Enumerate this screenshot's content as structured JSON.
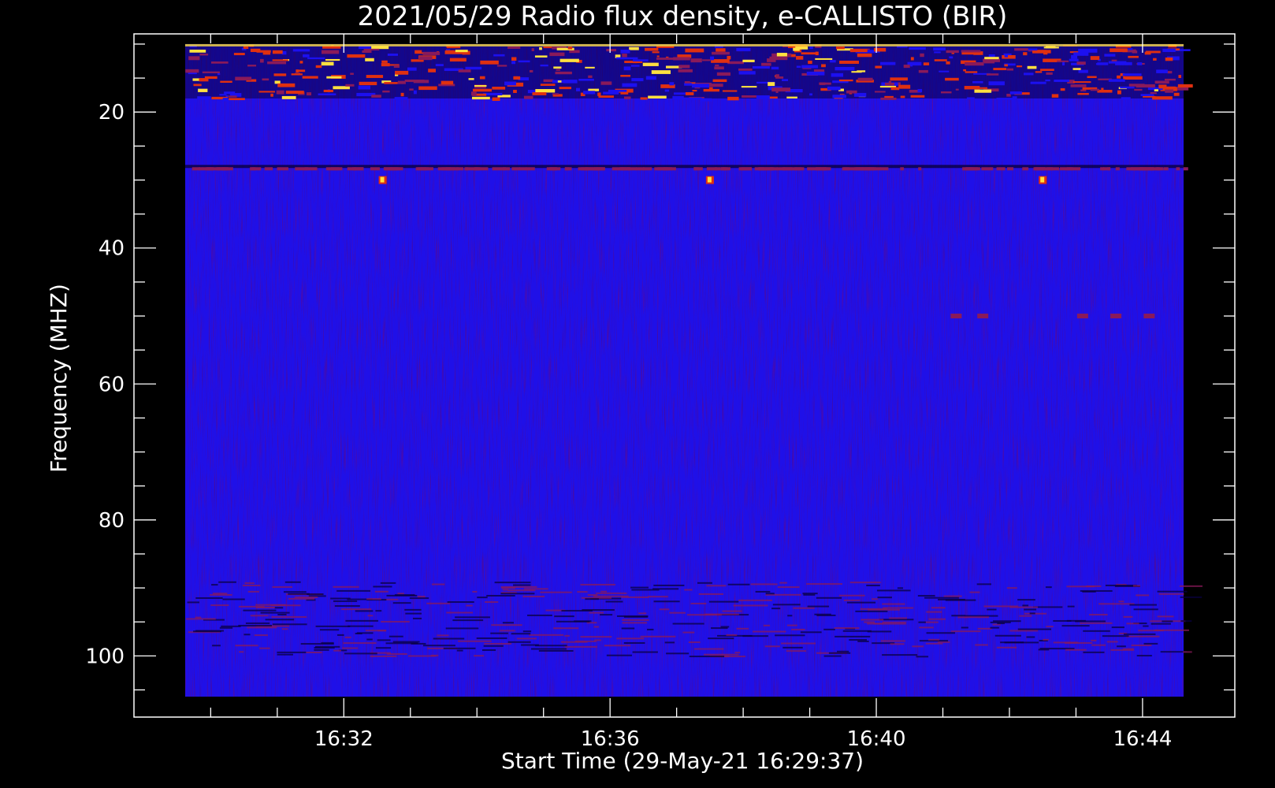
{
  "chart_data": {
    "type": "heatmap",
    "title": "2021/05/29  Radio flux density, e-CALLISTO (BIR)",
    "xlabel": "Start Time (29-May-21 16:29:37)",
    "ylabel": "Frequency (MHZ)",
    "x_range": [
      "16:29:37",
      "16:44:37"
    ],
    "ylim": [
      8.5,
      109
    ],
    "y_ticks": [
      "20",
      "40",
      "60",
      "80",
      "100"
    ],
    "x_ticks": [
      "16:32",
      "16:36",
      "16:40",
      "16:44"
    ],
    "data_freq_range_mhz": [
      10,
      106
    ],
    "background_color": "#1f10e8",
    "colors": {
      "low": "#0a0040",
      "mid": "#1c10f0",
      "elevated": "#8a1a5a",
      "high": "#e03010",
      "peak": "#ffe040"
    },
    "features": [
      {
        "name": "intense band near top",
        "freq_mhz": [
          10,
          18
        ],
        "intensity": "high"
      },
      {
        "name": "interference line",
        "freq_mhz": 28,
        "intensity": "elevated"
      },
      {
        "name": "bright spot",
        "time": "16:32:35",
        "freq_mhz": 30,
        "intensity": "peak"
      },
      {
        "name": "bright spot",
        "time": "16:37:30",
        "freq_mhz": 30,
        "intensity": "peak"
      },
      {
        "name": "bright spot",
        "time": "16:42:30",
        "freq_mhz": 30,
        "intensity": "peak"
      },
      {
        "name": "spots",
        "freq_mhz": 50,
        "intensity": "elevated"
      },
      {
        "name": "noise band",
        "freq_mhz": [
          89,
          100
        ],
        "intensity": "elevated"
      }
    ]
  }
}
